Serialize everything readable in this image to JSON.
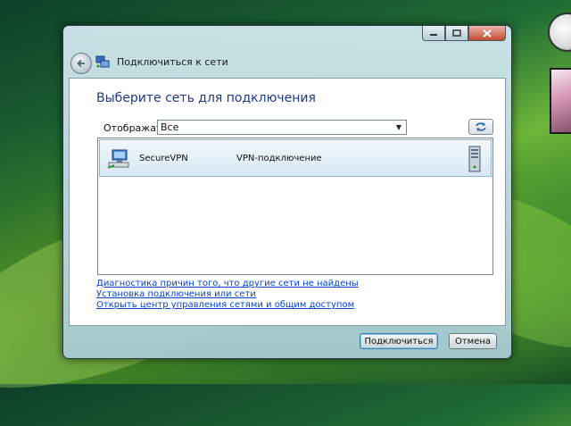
{
  "window": {
    "title": "Подключиться к сети",
    "heading": "Выберите сеть для подключения"
  },
  "filter": {
    "label": "Отображать",
    "selected": "Все"
  },
  "networks": [
    {
      "name": "SecureVPN",
      "type": "VPN-подключение"
    }
  ],
  "links": [
    "Диагностика причин того, что другие сети не найдены",
    "Установка подключения или сети",
    "Открыть центр управления сетями и общим доступом"
  ],
  "buttons": {
    "connect": "Подключиться",
    "cancel": "Отмена"
  },
  "icons": {
    "back": "back-arrow-icon",
    "refresh": "refresh-icon",
    "network": "vpn-network-icon",
    "server": "server-icon"
  },
  "colors": {
    "heading": "#1e3a8a",
    "link": "#0645c6",
    "selection_border": "#8fb5d1"
  }
}
